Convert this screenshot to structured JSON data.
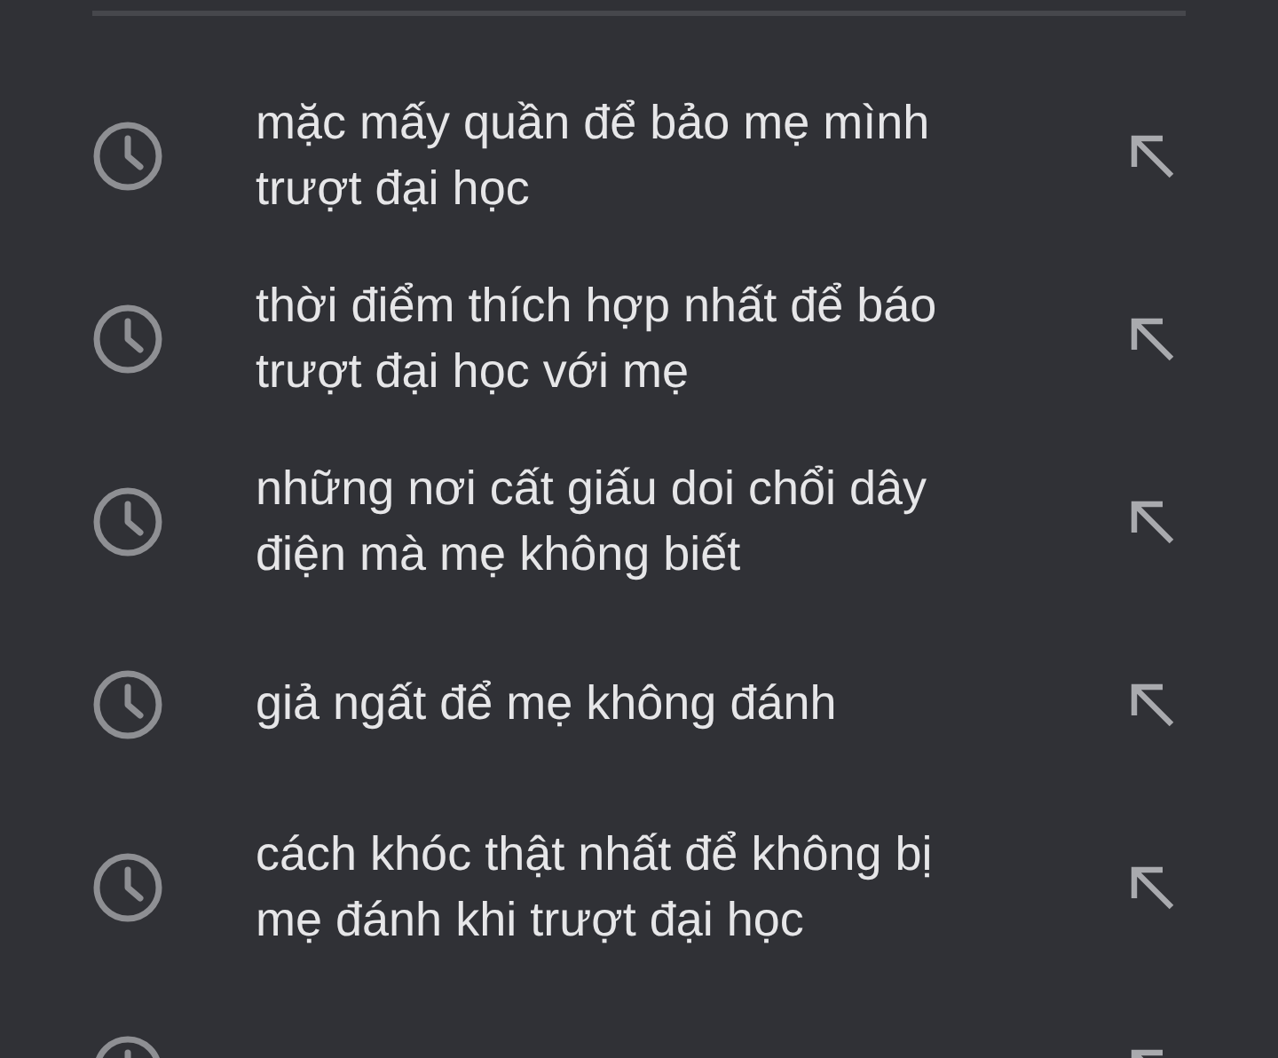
{
  "suggestions": [
    {
      "kind": "entry",
      "text": "mặc mấy quần để bảo mẹ mình\ntrượt đại học"
    },
    {
      "kind": "entry",
      "text": "thời điểm thích hợp nhất để báo\ntrượt đại học với mẹ"
    },
    {
      "kind": "entry",
      "text": "những nơi cất giấu doi chổi dây\nđiện mà mẹ không biết"
    },
    {
      "kind": "entry",
      "text": "giả ngất để mẹ không đánh"
    },
    {
      "kind": "entry",
      "text": "cách khóc thật nhất để không bị\nmẹ đánh khi trượt đại học"
    },
    {
      "kind": "cut_off"
    }
  ]
}
